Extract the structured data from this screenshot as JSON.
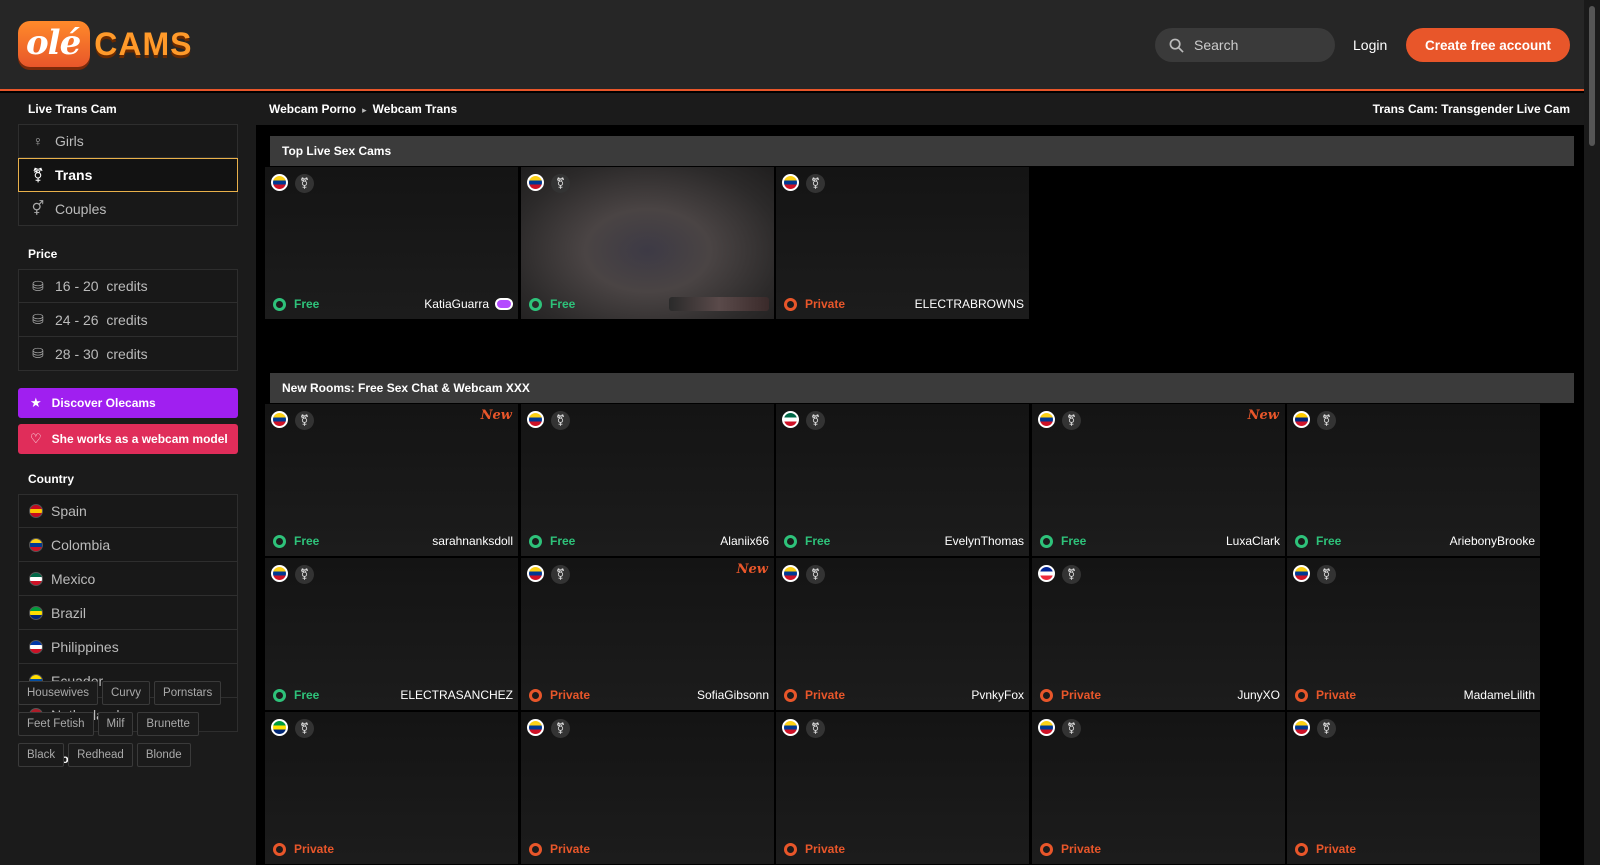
{
  "header": {
    "logo_ole": "olé",
    "logo_cams": "CAMS",
    "search_placeholder": "Search",
    "login_label": "Login",
    "create_account_label": "Create free account"
  },
  "breadcrumb": {
    "items": [
      "Webcam Porno",
      "Webcam Trans"
    ]
  },
  "page_title": "Trans Cam: Transgender Live Cam",
  "sidebar": {
    "title": "Live Trans Cam",
    "genders": [
      {
        "label": "Girls",
        "icon": "female-icon"
      },
      {
        "label": "Trans",
        "icon": "trans-icon",
        "active": true
      },
      {
        "label": "Couples",
        "icon": "couple-icon"
      }
    ],
    "price_title": "Price",
    "prices": [
      "16 - 20  credits",
      "24 - 26  credits",
      "28 - 30  credits"
    ],
    "discover_label": "Discover Olecams",
    "model_label": "She works as a webcam model",
    "country_title": "Country",
    "countries": [
      {
        "label": "Spain",
        "colors": [
          "#c60b1e",
          "#ffc400",
          "#c60b1e"
        ]
      },
      {
        "label": "Colombia",
        "colors": [
          "#fcd116",
          "#003893",
          "#ce1126"
        ]
      },
      {
        "label": "Mexico",
        "colors": [
          "#006847",
          "#ffffff",
          "#ce1126"
        ]
      },
      {
        "label": "Brazil",
        "colors": [
          "#009c3b",
          "#ffdf00",
          "#002776"
        ]
      },
      {
        "label": "Philippines",
        "colors": [
          "#0038a8",
          "#ffffff",
          "#ce1126"
        ]
      },
      {
        "label": "Ecuador",
        "colors": [
          "#ffdd00",
          "#034ea2",
          "#ed1c24"
        ]
      },
      {
        "label": "Netherlands",
        "colors": [
          "#ae1c28",
          "#ffffff",
          "#21468b"
        ]
      }
    ],
    "categories_title": "Categories",
    "categories": [
      "Housewives",
      "Curvy",
      "Pornstars",
      "Feet Fetish",
      "Milf",
      "Brunette",
      "Black",
      "Redhead",
      "Blonde"
    ]
  },
  "sections": {
    "top_title": "Top Live Sex Cams",
    "new_title": "New Rooms: Free Sex Chat & Webcam XXX"
  },
  "status_labels": {
    "free": "Free",
    "private": "Private",
    "new": "New"
  },
  "top_cams": [
    {
      "name": "KatiaGuarra",
      "status": "free",
      "flag": [
        "#fcd116",
        "#003893",
        "#ce1126"
      ],
      "hd": true
    },
    {
      "name": "",
      "status": "free",
      "flag": [
        "#fcd116",
        "#003893",
        "#ce1126"
      ],
      "blur": true,
      "hidden_name": true
    },
    {
      "name": "ELECTRABROWNS",
      "status": "private",
      "flag": [
        "#fcd116",
        "#003893",
        "#ce1126"
      ]
    }
  ],
  "new_cams": [
    {
      "name": "sarahnanksdoll",
      "status": "free",
      "new": true,
      "flag": [
        "#fcd116",
        "#003893",
        "#ce1126"
      ]
    },
    {
      "name": "Alaniix66",
      "status": "free",
      "flag": [
        "#fcd116",
        "#003893",
        "#ce1126"
      ]
    },
    {
      "name": "EvelynThomas",
      "status": "free",
      "flag": [
        "#006847",
        "#ffffff",
        "#ce1126"
      ]
    },
    {
      "name": "LuxaClark",
      "status": "free",
      "new": true,
      "flag": [
        "#fcd116",
        "#003893",
        "#ce1126"
      ]
    },
    {
      "name": "AriebonyBrooke",
      "status": "free",
      "flag": [
        "#ffcc00",
        "#00247d",
        "#cf142b"
      ]
    },
    {
      "name": "ELECTRASANCHEZ",
      "status": "free",
      "flag": [
        "#fcd116",
        "#003893",
        "#ce1126"
      ]
    },
    {
      "name": "SofiaGibsonn",
      "status": "private",
      "new": true,
      "flag": [
        "#fcd116",
        "#003893",
        "#ce1126"
      ]
    },
    {
      "name": "PvnkyFox",
      "status": "private",
      "flag": [
        "#fcd116",
        "#003893",
        "#ce1126"
      ]
    },
    {
      "name": "JunyXO",
      "status": "private",
      "flag": [
        "#002395",
        "#ffffff",
        "#ed2939"
      ]
    },
    {
      "name": "MadameLilith",
      "status": "private",
      "flag": [
        "#fcd116",
        "#003893",
        "#ce1126"
      ]
    },
    {
      "name": "",
      "status": "private",
      "flag": [
        "#009c3b",
        "#ffdf00",
        "#002776"
      ]
    },
    {
      "name": "",
      "status": "private",
      "flag": [
        "#fcd116",
        "#003893",
        "#ce1126"
      ]
    },
    {
      "name": "",
      "status": "private",
      "flag": [
        "#fcd116",
        "#003893",
        "#ce1126"
      ]
    },
    {
      "name": "",
      "status": "private",
      "flag": [
        "#fcd116",
        "#003893",
        "#ce1126"
      ]
    },
    {
      "name": "",
      "status": "private",
      "flag": [
        "#fcd116",
        "#003893",
        "#ce1126"
      ]
    }
  ],
  "colors": {
    "accent": "#e8562a",
    "free": "#2ec27a",
    "discover": "#a01ff0",
    "model": "#e02d5a"
  }
}
